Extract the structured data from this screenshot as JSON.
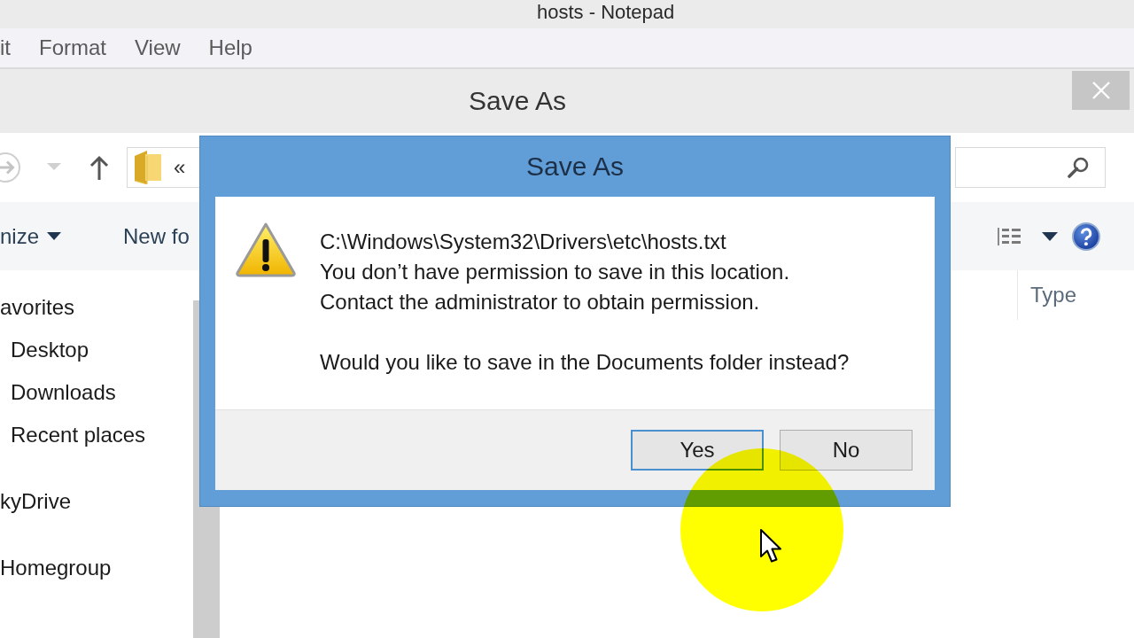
{
  "notepad": {
    "title": "hosts - Notepad",
    "menu": [
      "it",
      "Format",
      "View",
      "Help"
    ]
  },
  "save_as_window": {
    "title": "Save As",
    "address_bar": {
      "overflow": "«"
    },
    "toolbar": [
      {
        "label": "nize",
        "dropdown": true
      },
      {
        "label": "New fo",
        "dropdown": false
      }
    ],
    "nav_pane": [
      {
        "label": "avorites",
        "selected": false,
        "children": [
          {
            "label": "Desktop",
            "selected": false
          },
          {
            "label": "Downloads",
            "selected": false
          },
          {
            "label": "Recent places",
            "selected": false
          }
        ]
      },
      {
        "label": "kyDrive",
        "selected": false
      },
      {
        "label": "Homegroup",
        "selected": false
      }
    ],
    "columns": [
      "Type"
    ]
  },
  "dialog": {
    "title": "Save As",
    "message_lines": [
      "C:\\Windows\\System32\\Drivers\\etc\\hosts.txt",
      "You don’t have permission to save in this location.",
      "Contact the administrator to obtain permission."
    ],
    "question": "Would you like to save in the Documents folder instead?",
    "buttons": [
      {
        "label": "Yes",
        "default": true
      },
      {
        "label": "No",
        "default": false
      }
    ]
  }
}
